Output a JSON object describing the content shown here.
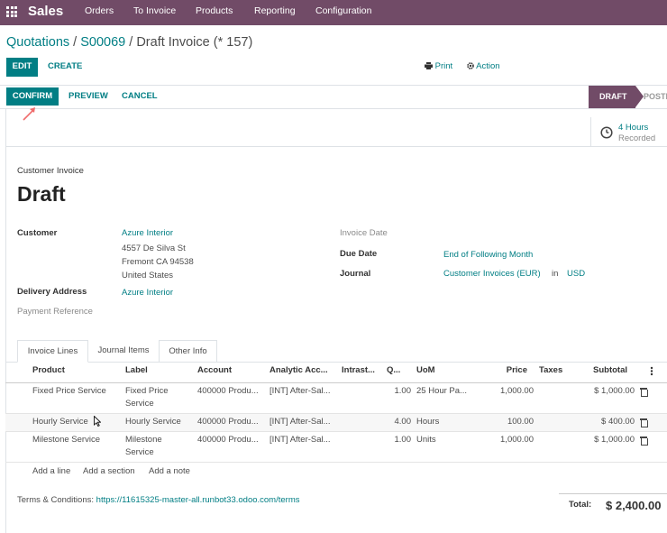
{
  "topnav": {
    "brand": "Sales",
    "menu": [
      "Orders",
      "To Invoice",
      "Products",
      "Reporting",
      "Configuration"
    ]
  },
  "breadcrumb": {
    "items": [
      "Quotations",
      "S00069"
    ],
    "separator": " / ",
    "current": "Draft Invoice (* 157)"
  },
  "controls": {
    "edit": "EDIT",
    "create": "CREATE",
    "print": "Print",
    "action": "Action"
  },
  "statusbar": {
    "confirm": "CONFIRM",
    "preview": "PREVIEW",
    "cancel": "CANCEL",
    "stages": [
      "DRAFT",
      "POSTED"
    ],
    "visible_post": "POSTI"
  },
  "smart_button": {
    "value": "4 Hours",
    "label": "Recorded"
  },
  "form": {
    "type_label": "Customer Invoice",
    "title": "Draft",
    "customer_label": "Customer",
    "customer_name": "Azure Interior",
    "customer_address": [
      "4557 De Silva St",
      "Fremont CA 94538",
      "United States"
    ],
    "delivery_label": "Delivery Address",
    "delivery_value": "Azure Interior",
    "payment_ref_label": "Payment Reference",
    "invoice_date_label": "Invoice Date",
    "due_date_label": "Due Date",
    "due_date_value": "End of Following Month",
    "journal_label": "Journal",
    "journal_value": "Customer Invoices (EUR)",
    "journal_in": "in",
    "currency": "USD"
  },
  "tabs": [
    "Invoice Lines",
    "Journal Items",
    "Other Info"
  ],
  "table": {
    "headers": {
      "product": "Product",
      "label": "Label",
      "account": "Account",
      "analytic": "Analytic Acc...",
      "intrastat": "Intrast...",
      "qty": "Q...",
      "uom": "UoM",
      "price": "Price",
      "taxes": "Taxes",
      "subtotal": "Subtotal"
    },
    "rows": [
      {
        "product": "Fixed Price Service",
        "label": "Fixed Price Service",
        "account": "400000 Produ...",
        "analytic": "[INT] After-Sal...",
        "qty": "1.00",
        "uom": "25 Hour Pa...",
        "price": "1,000.00",
        "subtotal": "$ 1,000.00"
      },
      {
        "product": "Hourly Service",
        "label": "Hourly Service",
        "account": "400000 Produ...",
        "analytic": "[INT] After-Sal...",
        "qty": "4.00",
        "uom": "Hours",
        "price": "100.00",
        "subtotal": "$ 400.00"
      },
      {
        "product": "Milestone Service",
        "label": "Milestone Service",
        "account": "400000 Produ...",
        "analytic": "[INT] After-Sal...",
        "qty": "1.00",
        "uom": "Units",
        "price": "1,000.00",
        "subtotal": "$ 1,000.00"
      }
    ],
    "add_line": "Add a line",
    "add_section": "Add a section",
    "add_note": "Add a note"
  },
  "footer": {
    "terms_label": "Terms & Conditions:",
    "terms_link": "https://11615325-master-all.runbot33.odoo.com/terms",
    "total_label": "Total:",
    "total_value": "$ 2,400.00"
  },
  "colors": {
    "brand": "#714b67",
    "accent": "#017e84",
    "annotation_arrow": "#f06b6b"
  }
}
